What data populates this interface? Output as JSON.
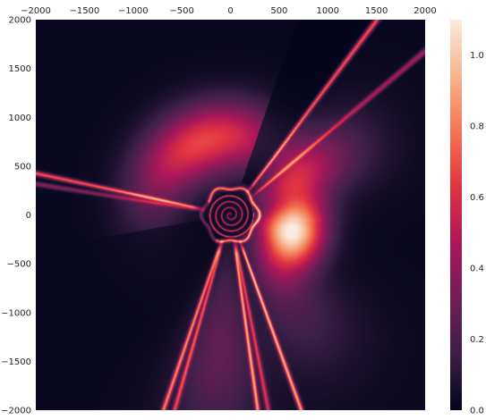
{
  "chart_data": {
    "type": "heatmap",
    "title": "",
    "xlabel": "",
    "ylabel": "",
    "xlim": [
      -2000,
      2000
    ],
    "ylim": [
      -2000,
      2000
    ],
    "x_axis_position": "top",
    "x_ticks": [
      -2000,
      -1500,
      -1000,
      -500,
      0,
      500,
      1000,
      1500,
      2000
    ],
    "x_tick_labels": [
      "−2000",
      "−1500",
      "−1000",
      "−500",
      "0",
      "500",
      "1000",
      "1500",
      "2000"
    ],
    "y_ticks": [
      2000,
      1500,
      1000,
      500,
      0,
      -500,
      -1000,
      -1500,
      -2000
    ],
    "y_tick_labels": [
      "2000",
      "1500",
      "1000",
      "500",
      "0",
      "−500",
      "−1000",
      "−1500",
      "−2000"
    ],
    "colorbar": {
      "range": [
        0.0,
        1.1
      ],
      "ticks": [
        0.0,
        0.2,
        0.4,
        0.6,
        0.8,
        1.0
      ],
      "tick_labels": [
        "0.0",
        "0.2",
        "0.4",
        "0.6",
        "0.8",
        "1.0"
      ],
      "colormap": "rocket",
      "colors": [
        "#03051a",
        "#3b1f47",
        "#701f57",
        "#ad1759",
        "#e13342",
        "#f37651",
        "#f6b48f",
        "#faebdd"
      ]
    },
    "grid": false,
    "features": {
      "spiral_center": [
        0,
        0
      ],
      "spiral_turns": 4,
      "spiral_max_radius": 240,
      "bright_halo_direction_deg": -15,
      "bright_halo_peak": 1.1,
      "warm_ring_center_deg": 110,
      "warm_ring_radius": 800,
      "warm_ring_value": 0.65,
      "rays": [
        {
          "angle_deg": 168,
          "value": 0.7
        },
        {
          "angle_deg": 171,
          "value": 0.35
        },
        {
          "angle_deg": 53,
          "value": 0.7
        },
        {
          "angle_deg": 40,
          "value": 0.45
        },
        {
          "angle_deg": -109,
          "value": 0.75
        },
        {
          "angle_deg": -106,
          "value": 0.6
        },
        {
          "angle_deg": -82,
          "value": 0.8
        },
        {
          "angle_deg": -79,
          "value": 0.55
        },
        {
          "angle_deg": -70,
          "value": 0.85
        }
      ]
    }
  }
}
